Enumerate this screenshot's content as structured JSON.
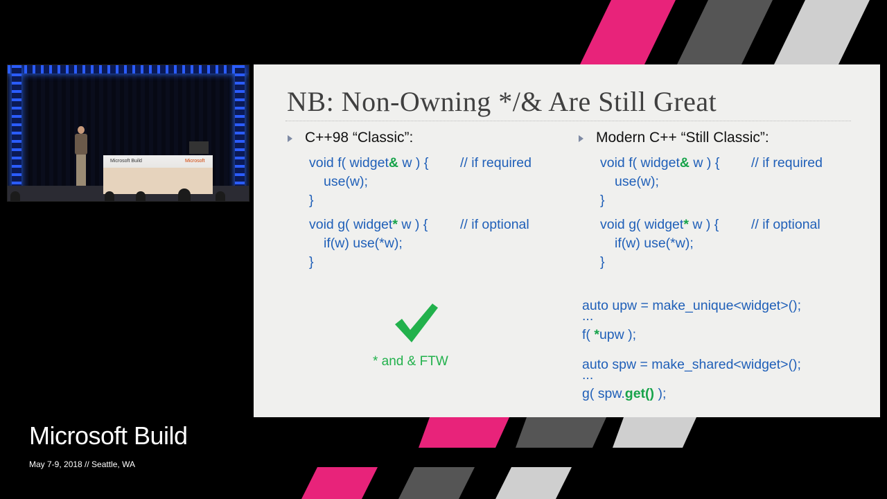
{
  "colors": {
    "background": "#000000",
    "accent_pink": "#e8237a",
    "stripe_gray": "#555555",
    "stripe_light": "#cfcfcf",
    "code_blue": "#1f5fb8",
    "code_green": "#17a34a",
    "slide_bg": "#f0f0ee"
  },
  "video": {
    "podium_label": "Microsoft Build",
    "podium_logo": "Microsoft"
  },
  "slide": {
    "title": "NB: Non-Owning */& Are Still Great",
    "left": {
      "heading": "C++98 “Classic”:",
      "f_decl_pre": "void f( widget",
      "f_decl_mark": "&",
      "f_decl_post": " w ) {",
      "f_comment": "// if required",
      "f_body": "use(w);",
      "f_close": "}",
      "g_decl_pre": "void g( widget",
      "g_decl_mark": "*",
      "g_decl_post": " w ) {",
      "g_comment": "// if optional",
      "g_body": "if(w) use(*w);",
      "g_close": "}",
      "verdict": "* and & FTW"
    },
    "right": {
      "heading": "Modern C++ “Still Classic”:",
      "f_decl_pre": "void f( widget",
      "f_decl_mark": "&",
      "f_decl_post": " w ) {",
      "f_comment": "// if required",
      "f_body": "use(w);",
      "f_close": "}",
      "g_decl_pre": "void g( widget",
      "g_decl_mark": "*",
      "g_decl_post": " w ) {",
      "g_comment": "// if optional",
      "g_body": "if(w) use(*w);",
      "g_close": "}",
      "upw_line": "auto upw = make_unique<widget>();",
      "ellipsis1": "...",
      "call_f_pre": "f( ",
      "call_f_mark": "*",
      "call_f_post": "upw );",
      "spw_line": "auto spw = make_shared<widget>();",
      "ellipsis2": "...",
      "call_g_pre": "g( spw.",
      "call_g_mark": "get()",
      "call_g_post": " );"
    }
  },
  "branding": {
    "title": "Microsoft Build",
    "subtitle": "May 7-9, 2018 // Seattle, WA"
  },
  "icons": [
    "checkmark-icon",
    "bullet-arrow-icon"
  ]
}
